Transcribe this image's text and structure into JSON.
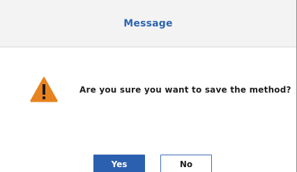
{
  "dialog": {
    "title": "Message",
    "message": "Are you sure you want to save the method?",
    "icon": "warning-icon",
    "yes_label": "Yes",
    "no_label": "No"
  },
  "colors": {
    "accent": "#2b5fb0",
    "title": "#2d64b0",
    "warning": "#e8821e",
    "header_bg": "#f3f3f3"
  }
}
